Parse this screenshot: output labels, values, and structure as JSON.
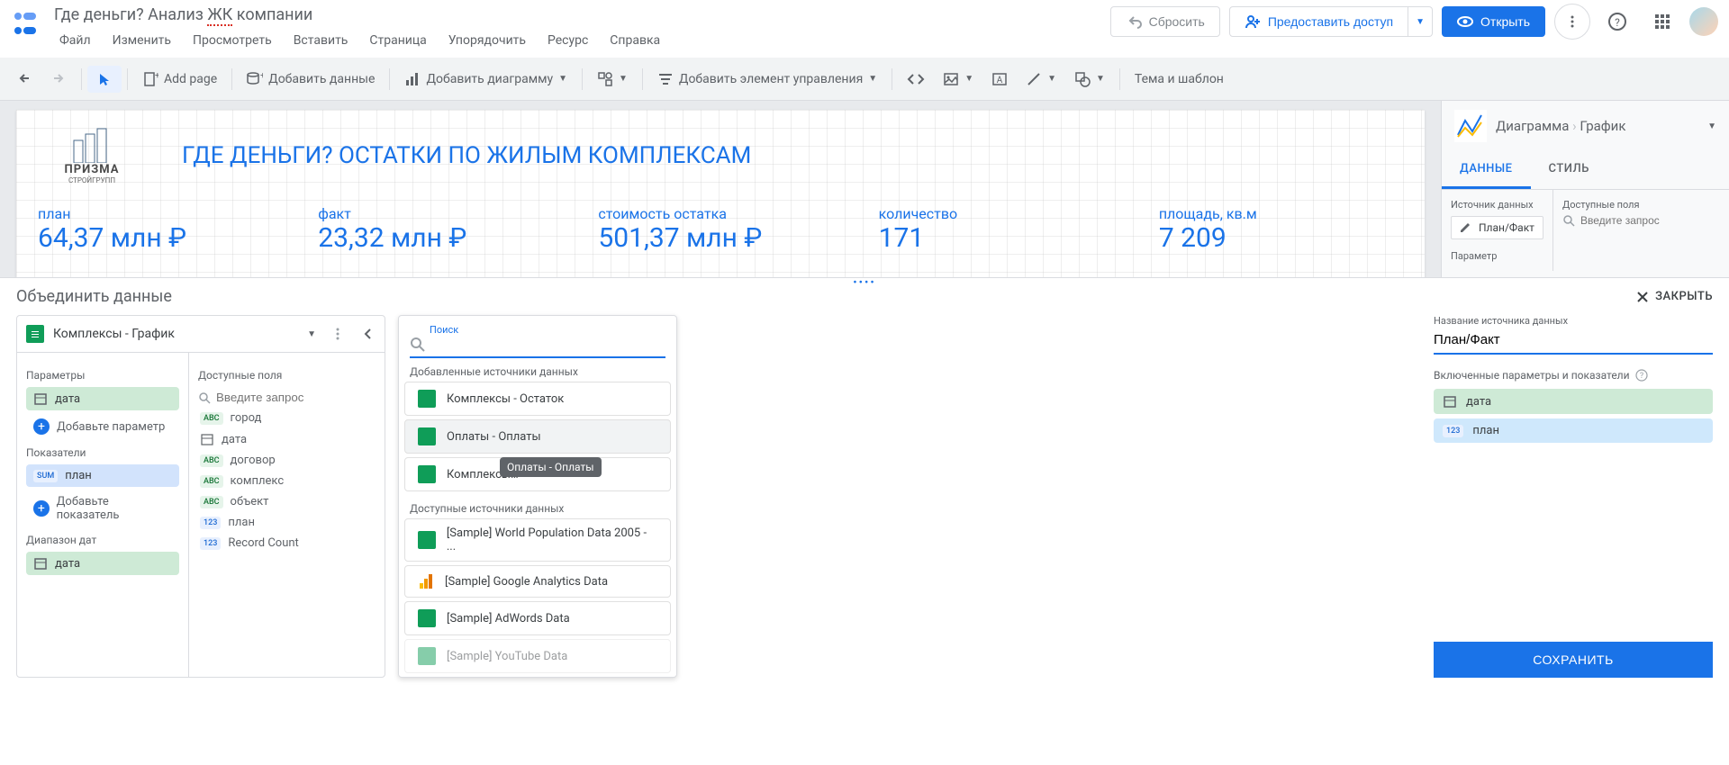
{
  "header": {
    "title_plain": "Где деньги? Анализ ",
    "title_squiggle": "ЖК",
    "title_tail": " компании",
    "menu": [
      "Файл",
      "Изменить",
      "Просмотреть",
      "Вставить",
      "Страница",
      "Упорядочить",
      "Ресурс",
      "Справка"
    ],
    "reset": "Сбросить",
    "share": "Предоставить доступ",
    "open": "Открыть"
  },
  "toolbar": {
    "add_page": "Add page",
    "add_data": "Добавить данные",
    "add_chart": "Добавить диаграмму",
    "add_control": "Добавить элемент управления",
    "theme": "Тема и шаблон"
  },
  "report": {
    "logo_name": "ПРИЗМА",
    "logo_sub": "СТРОЙГРУПП",
    "title": "ГДЕ ДЕНЬГИ? ОСТАТКИ ПО ЖИЛЫМ КОМПЛЕКСАМ",
    "kpis": [
      {
        "label": "план",
        "value": "64,37 млн ₽"
      },
      {
        "label": "факт",
        "value": "23,32 млн ₽"
      },
      {
        "label": "стоимость остатка",
        "value": "501,37 млн ₽"
      },
      {
        "label": "количество",
        "value": "171"
      },
      {
        "label": "площадь, кв.м",
        "value": "7 209"
      }
    ]
  },
  "right_panel": {
    "breadcrumb_a": "Диаграмма",
    "breadcrumb_b": "График",
    "tabs": [
      "ДАННЫЕ",
      "СТИЛЬ"
    ],
    "source_label": "Источник данных",
    "source_value": "План/Факт",
    "fields_label": "Доступные поля",
    "search_placeholder": "Введите запрос",
    "param_label": "Параметр"
  },
  "blend": {
    "title": "Объединить данные",
    "close": "ЗАКРЫТЬ"
  },
  "left_panel": {
    "datasource": "Комплексы - График",
    "params_label": "Параметры",
    "metrics_label": "Показатели",
    "daterange_label": "Диапазон дат",
    "add_param": "Добавьте параметр",
    "add_metric": "Добавьте показатель",
    "param_date": "дата",
    "metric_plan": "план",
    "dr_date": "дата",
    "available_label": "Доступные поля",
    "search_placeholder": "Введите запрос",
    "fields": [
      {
        "type": "ABC",
        "name": "город"
      },
      {
        "type": "cal",
        "name": "дата"
      },
      {
        "type": "ABC",
        "name": "договор"
      },
      {
        "type": "ABC",
        "name": "комплекс"
      },
      {
        "type": "ABC",
        "name": "объект"
      },
      {
        "type": "123",
        "name": "план"
      },
      {
        "type": "123",
        "name": "Record Count"
      }
    ]
  },
  "search_card": {
    "search_label": "Поиск",
    "added_label": "Добавленные источники данных",
    "added": [
      "Комплексы - Остаток",
      "Оплаты - Оплаты",
      "Комплексы - График"
    ],
    "available_label": "Доступные источники данных",
    "available": [
      "[Sample] World Population Data 2005 - ...",
      "[Sample] Google Analytics Data",
      "[Sample] AdWords Data",
      "[Sample] YouTube Data"
    ],
    "tooltip": "Оплаты - Оплаты"
  },
  "far_right": {
    "name_label": "Название источника данных",
    "name_value": "План/Факт",
    "included_label": "Включенные параметры и показатели",
    "chip_date": "дата",
    "chip_plan": "план",
    "save": "СОХРАНИТЬ"
  }
}
